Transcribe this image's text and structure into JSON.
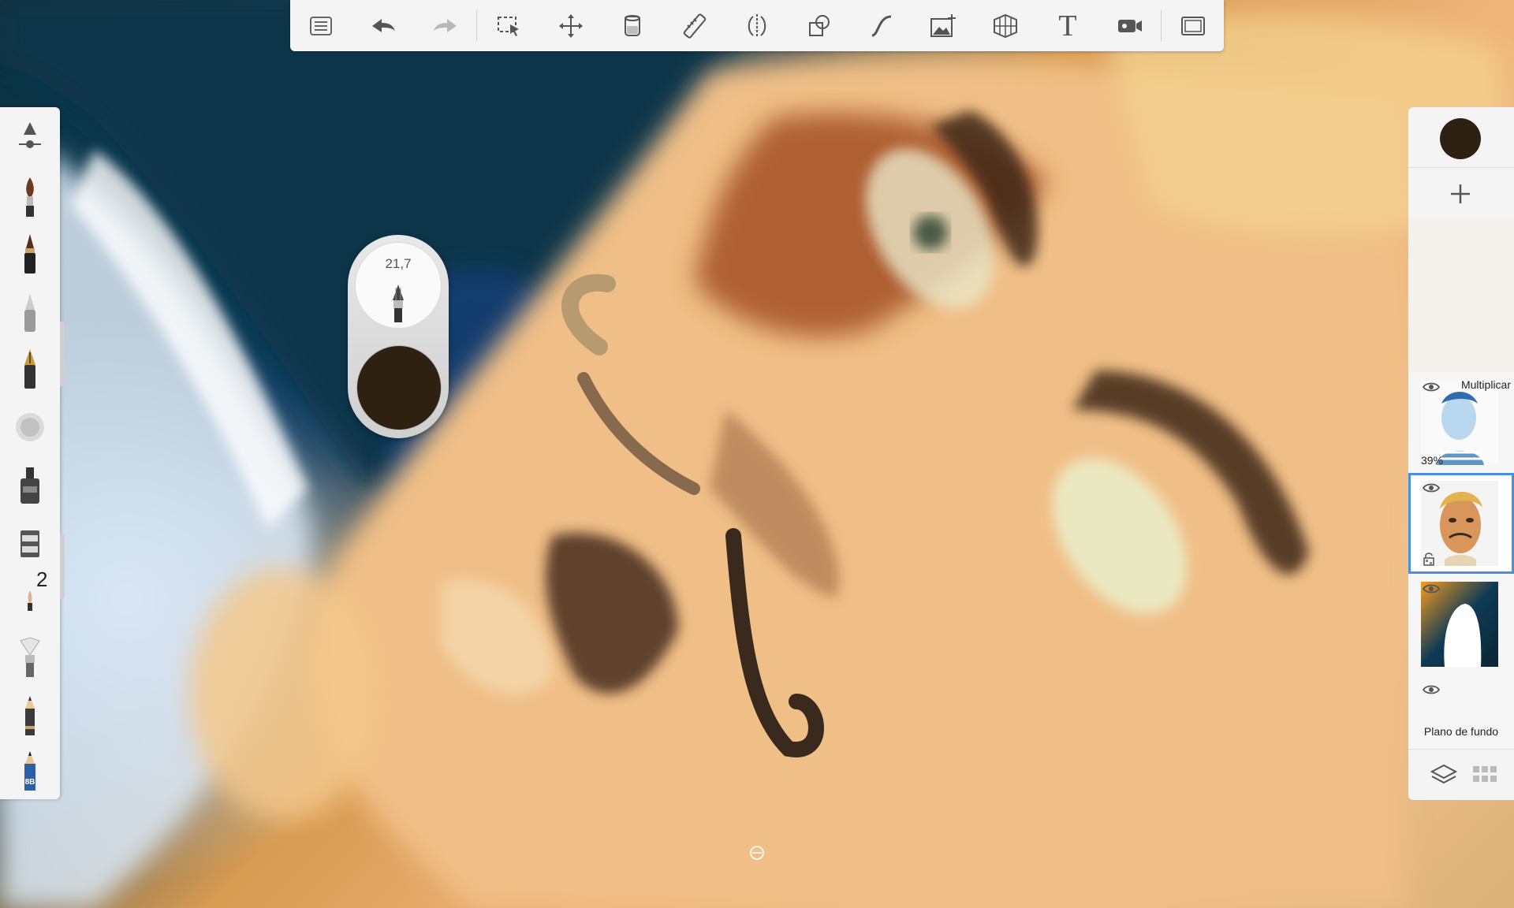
{
  "app": "Sketchbook",
  "toolbar": {
    "items": [
      {
        "icon": "list-icon"
      },
      {
        "icon": "undo-icon"
      },
      {
        "icon": "redo-icon"
      },
      {
        "icon": "selection-icon"
      },
      {
        "icon": "transform-icon"
      },
      {
        "icon": "fill-icon"
      },
      {
        "icon": "ruler-icon"
      },
      {
        "icon": "symmetry-icon"
      },
      {
        "icon": "shapes-icon"
      },
      {
        "icon": "curve-icon"
      },
      {
        "icon": "add-image-icon"
      },
      {
        "icon": "perspective-icon"
      },
      {
        "icon": "text-icon"
      },
      {
        "icon": "record-icon"
      },
      {
        "icon": "fullscreen-icon"
      }
    ],
    "text_label": "T"
  },
  "brushes": {
    "items": [
      "brush-settings",
      "paint-brush",
      "marker",
      "airbrush",
      "ink-pen",
      "spray",
      "ink-bottle",
      "eraser-block",
      "small-brush",
      "fan-brush",
      "pencil",
      "pencil-8b"
    ],
    "badge": "2",
    "pencil_label": "8B"
  },
  "puck": {
    "size_value": "21,7",
    "color": "#2e2112"
  },
  "layers": {
    "current_color": "#2e2112",
    "items": [
      {
        "name": "layer-sketch",
        "mode": "Multiplicar",
        "opacity": "39%",
        "active": false
      },
      {
        "name": "layer-portrait",
        "mode": "",
        "opacity": "",
        "active": true
      },
      {
        "name": "layer-background-paint",
        "mode": "",
        "opacity": "",
        "active": false
      }
    ],
    "background_label": "Plano de fundo"
  },
  "colors": {
    "accent": "#4a8fe0",
    "panel": "#f4f4f4",
    "icon": "#555555"
  }
}
